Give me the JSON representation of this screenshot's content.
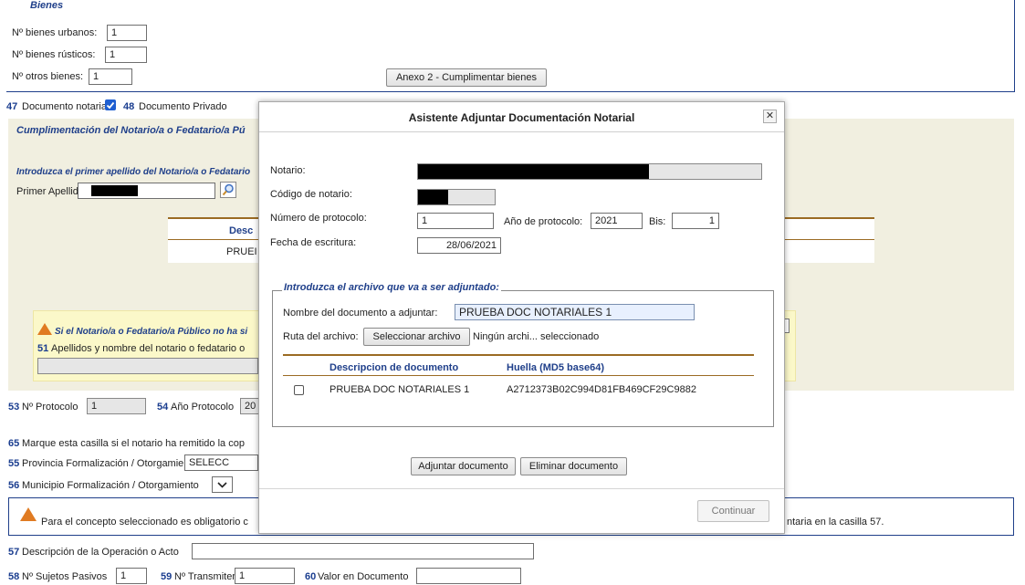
{
  "bienes": {
    "title": "Bienes",
    "urbanos_label": "Nº bienes urbanos:",
    "urbanos_value": "1",
    "rusticos_label": "Nº bienes rústicos:",
    "rusticos_value": "1",
    "otros_label": "Nº otros bienes:",
    "otros_value": "1",
    "anexo_button": "Anexo 2 - Cumplimentar bienes"
  },
  "docs": {
    "c47_num": "47",
    "c47_label": "Documento notarial",
    "c48_num": "48",
    "c48_label": "Documento Privado"
  },
  "notario_section": {
    "title": "Cumplimentación del Notario/a o Fedatario/a Pú",
    "instruction": "Introduzca el primer apellido del Notario/a o Fedatario",
    "apellido_label": "Primer Apellido",
    "col_header": "Desc",
    "row_value": "PRUEI",
    "warning_text": "Si el Notario/a o Fedatario/a Público no ha si",
    "c51_num": "51",
    "c51_label": "Apellidos y nombre del notario o fedatario o"
  },
  "protocolo": {
    "c53_num": "53",
    "c53_label": "Nº Protocolo",
    "c53_value": "1",
    "c54_num": "54",
    "c54_label": "Año Protocolo",
    "c54_value": "20"
  },
  "formalizacion": {
    "c65_num": "65",
    "c65_label": "Marque esta casilla si el notario ha remitido la cop",
    "c55_num": "55",
    "c55_label": "Provincia Formalización / Otorgamiento",
    "c55_value": "SELECC",
    "c56_num": "56",
    "c56_label": "Municipio Formalización / Otorgamiento"
  },
  "alert": {
    "text_left": "Para el concepto seleccionado es obligatorio c",
    "text_right": "ntaria en la casilla 57."
  },
  "operacion": {
    "c57_num": "57",
    "c57_label": "Descripción de la Operación o Acto",
    "c58_num": "58",
    "c58_label": "Nº Sujetos Pasivos",
    "c58_value": "1",
    "c59_num": "59",
    "c59_label": "Nº Transmitentes",
    "c59_value": "1",
    "c60_num": "60",
    "c60_label": "Valor en Documento"
  },
  "modal": {
    "title": "Asistente Adjuntar Documentación Notarial",
    "close_glyph": "✕",
    "notario_label": "Notario:",
    "codigo_label": "Código de notario:",
    "numero_label": "Número de protocolo:",
    "numero_value": "1",
    "anio_label": "Año de protocolo:",
    "anio_value": "2021",
    "bis_label": "Bis:",
    "bis_value": "1",
    "fecha_label": "Fecha de escritura:",
    "fecha_value": "28/06/2021",
    "file_section": {
      "legend": "Introduzca el archivo que va a ser adjuntado:",
      "nombre_label": "Nombre del documento a adjuntar:",
      "nombre_value": "PRUEBA DOC NOTARIALES 1",
      "ruta_label": "Ruta del archivo:",
      "select_button": "Seleccionar archivo",
      "no_file_text": "Ningún archi... seleccionado",
      "col_desc": "Descripcion de documento",
      "col_hash": "Huella (MD5 base64)",
      "rows": [
        {
          "desc": "PRUEBA DOC NOTARIALES 1",
          "hash": "A2712373B02C994D81FB469CF29C9882"
        }
      ]
    },
    "adjuntar_button": "Adjuntar documento",
    "eliminar_button": "Eliminar documento",
    "continuar_button": "Continuar"
  },
  "colors": {
    "accent_blue": "#1f3f8a",
    "beige_panel": "#f1efe0",
    "warning_orange": "#e07b22"
  }
}
